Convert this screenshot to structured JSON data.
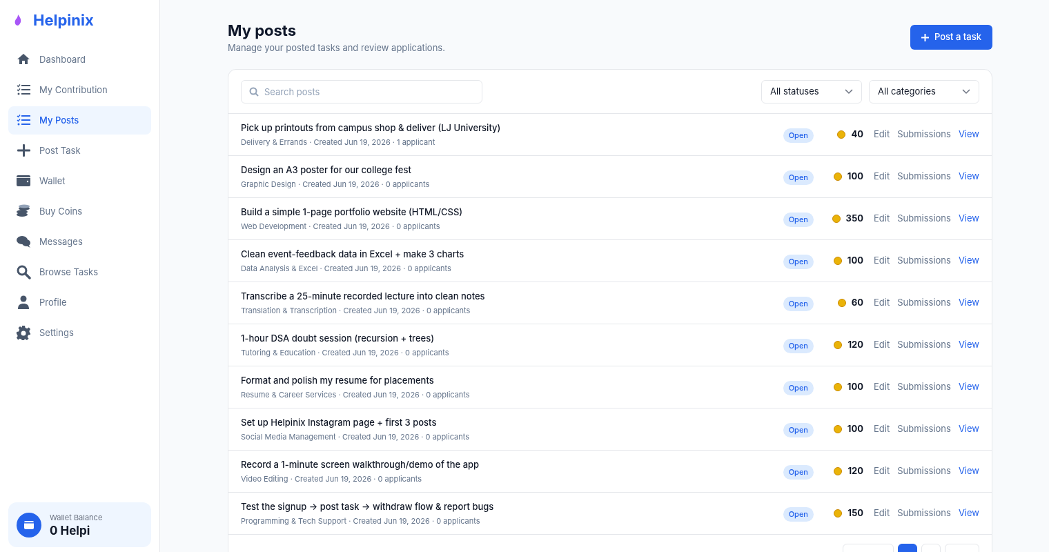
{
  "brand": {
    "name": "Helpinix"
  },
  "sidebar": {
    "items": [
      {
        "label": "Dashboard",
        "kind": "home",
        "selected": false
      },
      {
        "label": "My Contribution",
        "kind": "list",
        "selected": false
      },
      {
        "label": "My Posts",
        "kind": "list",
        "selected": true
      },
      {
        "label": "Post Task",
        "kind": "plus",
        "selected": false
      },
      {
        "label": "Wallet",
        "kind": "wallet",
        "selected": false
      },
      {
        "label": "Buy Coins",
        "kind": "coins",
        "selected": false
      },
      {
        "label": "Messages",
        "kind": "chat",
        "selected": false
      },
      {
        "label": "Browse Tasks",
        "kind": "search",
        "selected": false
      },
      {
        "label": "Profile",
        "kind": "user",
        "selected": false
      },
      {
        "label": "Settings",
        "kind": "gear",
        "selected": false
      }
    ]
  },
  "wallet": {
    "label": "Wallet Balance",
    "amount": "0 Helpi"
  },
  "header": {
    "title": "My posts",
    "subtitle": "Manage your posted tasks and review applications.",
    "button": "Post a task"
  },
  "filters": {
    "search_placeholder": "Search posts",
    "status": "All statuses",
    "category": "All categories"
  },
  "posts": [
    {
      "title": "Pick up printouts from campus shop & deliver (LJ University)",
      "meta": "Delivery & Errands · Created Jun 19, 2026 · 1 applicant",
      "status": "Open",
      "reward": "40",
      "actions": [
        "Edit",
        "Submissions",
        "View"
      ]
    },
    {
      "title": "Design an A3 poster for our college fest",
      "meta": "Graphic Design · Created Jun 19, 2026 · 0 applicants",
      "status": "Open",
      "reward": "100",
      "actions": [
        "Edit",
        "Submissions",
        "View"
      ]
    },
    {
      "title": "Build a simple 1-page portfolio website (HTML/CSS)",
      "meta": "Web Development · Created Jun 19, 2026 · 0 applicants",
      "status": "Open",
      "reward": "350",
      "actions": [
        "Edit",
        "Submissions",
        "View"
      ]
    },
    {
      "title": "Clean event-feedback data in Excel + make 3 charts",
      "meta": "Data Analysis & Excel · Created Jun 19, 2026 · 0 applicants",
      "status": "Open",
      "reward": "100",
      "actions": [
        "Edit",
        "Submissions",
        "View"
      ]
    },
    {
      "title": "Transcribe a 25-minute recorded lecture into clean notes",
      "meta": "Translation & Transcription · Created Jun 19, 2026 · 0 applicants",
      "status": "Open",
      "reward": "60",
      "actions": [
        "Edit",
        "Submissions",
        "View"
      ]
    },
    {
      "title": "1-hour DSA doubt session (recursion + trees)",
      "meta": "Tutoring & Education · Created Jun 19, 2026 · 0 applicants",
      "status": "Open",
      "reward": "120",
      "actions": [
        "Edit",
        "Submissions",
        "View"
      ]
    },
    {
      "title": "Format and polish my resume for placements",
      "meta": "Resume & Career Services · Created Jun 19, 2026 · 0 applicants",
      "status": "Open",
      "reward": "100",
      "actions": [
        "Edit",
        "Submissions",
        "View"
      ]
    },
    {
      "title": "Set up Helpinix Instagram page + first 3 posts",
      "meta": "Social Media Management · Created Jun 19, 2026 · 0 applicants",
      "status": "Open",
      "reward": "100",
      "actions": [
        "Edit",
        "Submissions",
        "View"
      ]
    },
    {
      "title": "Record a 1-minute screen walkthrough/demo of the app",
      "meta": "Video Editing · Created Jun 19, 2026 · 0 applicants",
      "status": "Open",
      "reward": "120",
      "actions": [
        "Edit",
        "Submissions",
        "View"
      ]
    },
    {
      "title": "Test the signup → post task → withdraw flow & report bugs",
      "meta": "Programming & Tech Support · Created Jun 19, 2026 · 0 applicants",
      "status": "Open",
      "reward": "150",
      "actions": [
        "Edit",
        "Submissions",
        "View"
      ]
    }
  ],
  "pagination": {
    "pages": [
      {
        "selected": false
      },
      {
        "selected": true
      },
      {
        "selected": false
      },
      {
        "selected": false
      }
    ]
  }
}
